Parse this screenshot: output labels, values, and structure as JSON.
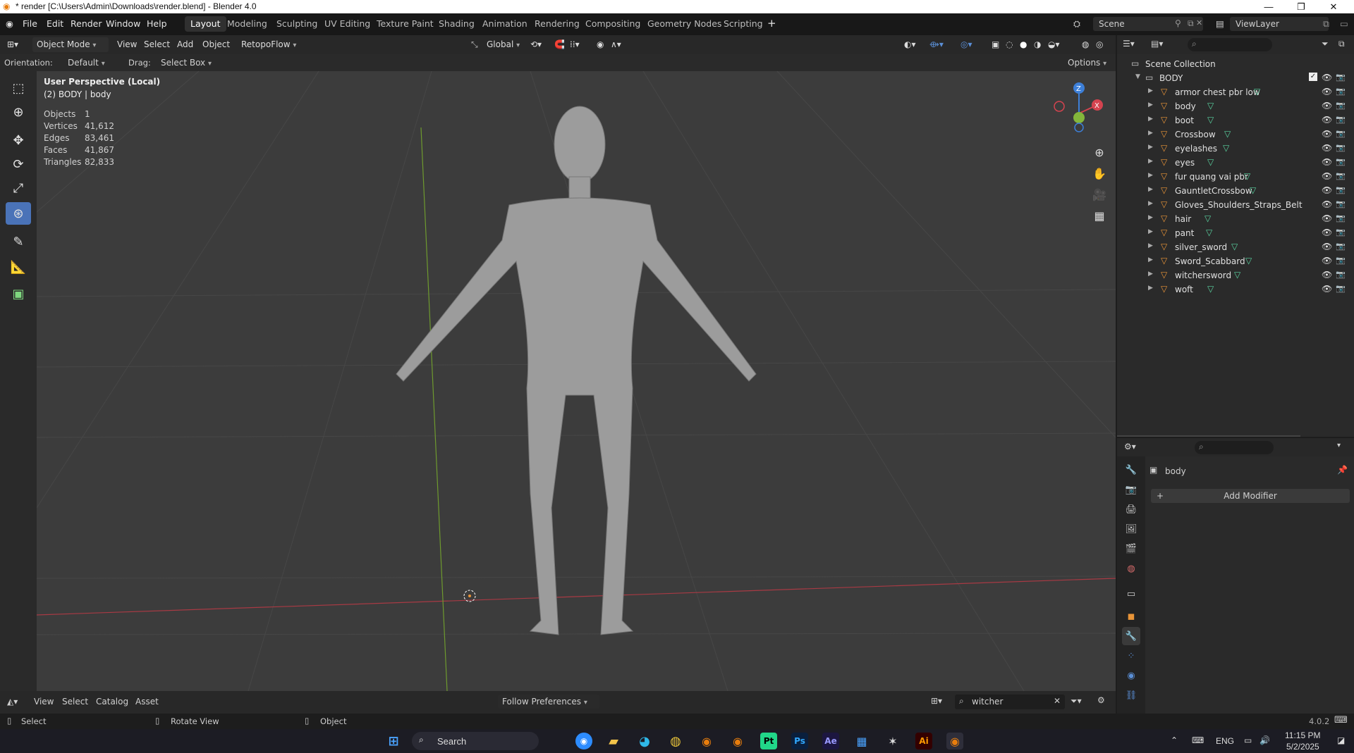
{
  "window": {
    "title": "* render [C:\\Users\\Admin\\Downloads\\render.blend] - Blender 4.0"
  },
  "menu": [
    "File",
    "Edit",
    "Render",
    "Window",
    "Help"
  ],
  "workspaces": [
    "Layout",
    "Modeling",
    "Sculpting",
    "UV Editing",
    "Texture Paint",
    "Shading",
    "Animation",
    "Rendering",
    "Compositing",
    "Geometry Nodes",
    "Scripting"
  ],
  "active_workspace": "Layout",
  "scene": {
    "name": "Scene",
    "view_layer": "ViewLayer"
  },
  "header": {
    "mode": "Object Mode",
    "view": "View",
    "select": "Select",
    "add": "Add",
    "object": "Object",
    "addon": "RetopoFlow",
    "transform": "Global"
  },
  "tool_settings": {
    "orientation_label": "Orientation:",
    "orientation_value": "Default",
    "drag_label": "Drag:",
    "drag_value": "Select Box",
    "options": "Options"
  },
  "viewport": {
    "view_name": "User Perspective (Local)",
    "context": "(2) BODY | body",
    "stats": [
      {
        "label": "Objects",
        "value": "1"
      },
      {
        "label": "Vertices",
        "value": "41,612"
      },
      {
        "label": "Edges",
        "value": "83,461"
      },
      {
        "label": "Faces",
        "value": "41,867"
      },
      {
        "label": "Triangles",
        "value": "82,833"
      }
    ],
    "gizmo": {
      "z": "Z",
      "x": "X"
    }
  },
  "outliner": {
    "root": "Scene Collection",
    "collection": "BODY",
    "items": [
      "armor chest pbr low",
      "body",
      "boot",
      "Crossbow",
      "eyelashes",
      "eyes",
      "fur quang vai pbr",
      "GauntletCrossbow",
      "Gloves_Shoulders_Straps_Belt",
      "hair",
      "pant",
      "silver_sword",
      "Sword_Scabbard",
      "witchersword",
      "woft"
    ]
  },
  "properties": {
    "object_name": "body",
    "add_modifier": "Add Modifier"
  },
  "assetbar": {
    "view": "View",
    "select": "Select",
    "catalog": "Catalog",
    "asset": "Asset",
    "import_method": "Follow Preferences",
    "search_value": "witcher"
  },
  "statusbar": {
    "select": "Select",
    "rotate": "Rotate View",
    "object": "Object",
    "version": "4.0.2"
  },
  "taskbar": {
    "search": "Search",
    "lang": "ENG",
    "time": "11:15 PM",
    "date": "5/2/2025"
  },
  "colors": {
    "accent": "#4a73b8",
    "object_orange": "#e89438",
    "mesh_green": "#5ad3a0",
    "x_axis": "#d4434f",
    "y_axis": "#84b63b",
    "z_axis": "#3d7fd8"
  }
}
